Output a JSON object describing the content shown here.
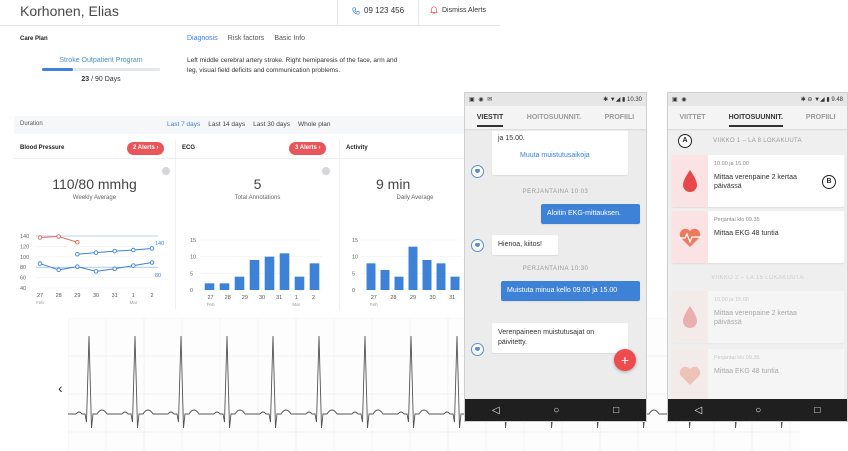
{
  "dashboard": {
    "patient_name": "Korhonen, Elias",
    "phone": "09 123 456",
    "dismiss_label": "Dismiss Alerts",
    "care_plan_label": "Care Plan",
    "program": {
      "name": "Stroke Outpatient Program",
      "days_done": "23",
      "days_text": " / 90 Days",
      "progress": 0.26
    },
    "tabs": [
      "Diagnosis",
      "Risk factors",
      "Basic Info"
    ],
    "diagnosis_text": "Left middle cerebral artery stroke. Right hemiparesis of the face, arm and leg, visual field deficits and communication problems.",
    "duration": {
      "label": "Duration",
      "options": [
        "Last 7 days",
        "Last 14 days",
        "Last 30 days",
        "Whole plan"
      ],
      "selected": 0
    },
    "cards": [
      {
        "title": "Blood Pressure",
        "alerts": "2 Alerts",
        "value": "110/80 mmhg",
        "sub": "Weekly Average"
      },
      {
        "title": "ECG",
        "alerts": "3 Alerts",
        "value": "5",
        "sub": "Total Annotations"
      },
      {
        "title": "Activity",
        "alerts": "",
        "value": "9 min",
        "sub": "Daily Average"
      }
    ],
    "colors": {
      "accent": "#3d82d6",
      "alert": "#e9555a",
      "systolic": "#e06b62"
    }
  },
  "chart_data": [
    {
      "type": "line",
      "title": "Blood Pressure",
      "x": [
        "27",
        "28",
        "29",
        "30",
        "31",
        "1",
        "2"
      ],
      "month_labels": [
        "Feb",
        "Mar"
      ],
      "ylim": [
        40,
        140
      ],
      "y_ticks": [
        140,
        120,
        100,
        80,
        60,
        40
      ],
      "right_ticks": [
        "140",
        "80"
      ],
      "series": [
        {
          "values": [
            137,
            139,
            128,
            null,
            null,
            null,
            null
          ]
        },
        {
          "values": [
            null,
            null,
            105,
            108,
            111,
            113,
            116
          ]
        },
        {
          "values": [
            87,
            75,
            81,
            72,
            77,
            83,
            89
          ]
        }
      ]
    },
    {
      "type": "bar",
      "title": "ECG",
      "categories": [
        "27",
        "28",
        "29",
        "30",
        "31",
        "1",
        "2"
      ],
      "month_labels": [
        "Feb",
        "Mar"
      ],
      "ylim": [
        0,
        15
      ],
      "y_ticks": [
        15,
        10,
        5,
        0
      ],
      "values": [
        2,
        2,
        4,
        9,
        10,
        11,
        4,
        8
      ]
    },
    {
      "type": "bar",
      "title": "Activity",
      "categories": [
        "27",
        "28",
        "29",
        "30",
        "31"
      ],
      "month_labels": [
        "Feb"
      ],
      "ylim": [
        0,
        15
      ],
      "y_ticks": [
        15,
        10,
        5,
        0
      ],
      "values": [
        8,
        6,
        4,
        13,
        9,
        8,
        4
      ]
    }
  ],
  "phone1": {
    "status_time": "10.30",
    "tabs": [
      "VIESTIT",
      "HOITOSUUNNIT.",
      "PROFIILI"
    ],
    "active_tab": 0,
    "messages": [
      {
        "kind": "in",
        "text": "ja 15.00.",
        "link": "Muuta muistutusaikoja"
      },
      {
        "kind": "sep",
        "text": "PERJANTAINA 10:03"
      },
      {
        "kind": "out",
        "text": "Aloitin EKG-mittauksen."
      },
      {
        "kind": "in",
        "text": "Hienoa, kiitos!"
      },
      {
        "kind": "sep",
        "text": "PERJANTAINA 10:30"
      },
      {
        "kind": "out",
        "text": "Muistuta minua kello 09.00 ja 15.00"
      },
      {
        "kind": "in",
        "text": "Verenpaineen muistutusajat on päivitetty."
      }
    ],
    "fab_label": "+"
  },
  "phone2": {
    "status_time": "9.48",
    "tabs": [
      "VIITTET",
      "HOITOSUUNNIT.",
      "PROFIILI"
    ],
    "active_tab": 1,
    "week1": "VIIKKO 1 – LA 8 LOKAKUUTA",
    "week2": "VIIKKO 2 – LA 15 LOKAKUUTA",
    "tasks": [
      {
        "time": "10.00 ja 15.00",
        "title": "Mittaa verenpaine 2 kertaa päivässä",
        "icon": "blood-drop-icon",
        "faded": false
      },
      {
        "time": "Perjantai klo 09.35",
        "title": "Mittaa EKG 48 tuntia",
        "icon": "heart-pulse-icon",
        "faded": false
      },
      {
        "time": "10.00 ja 15.00",
        "title": "Mittaa verenpaine 2 kertaa päivässä",
        "icon": "blood-drop-icon",
        "faded": true
      },
      {
        "time": "Perjantai klo 09.35",
        "title": "Mittaa EKG 48 tuntia",
        "icon": "heart-pulse-icon",
        "faded": true
      }
    ],
    "callouts": [
      "A",
      "B"
    ]
  }
}
